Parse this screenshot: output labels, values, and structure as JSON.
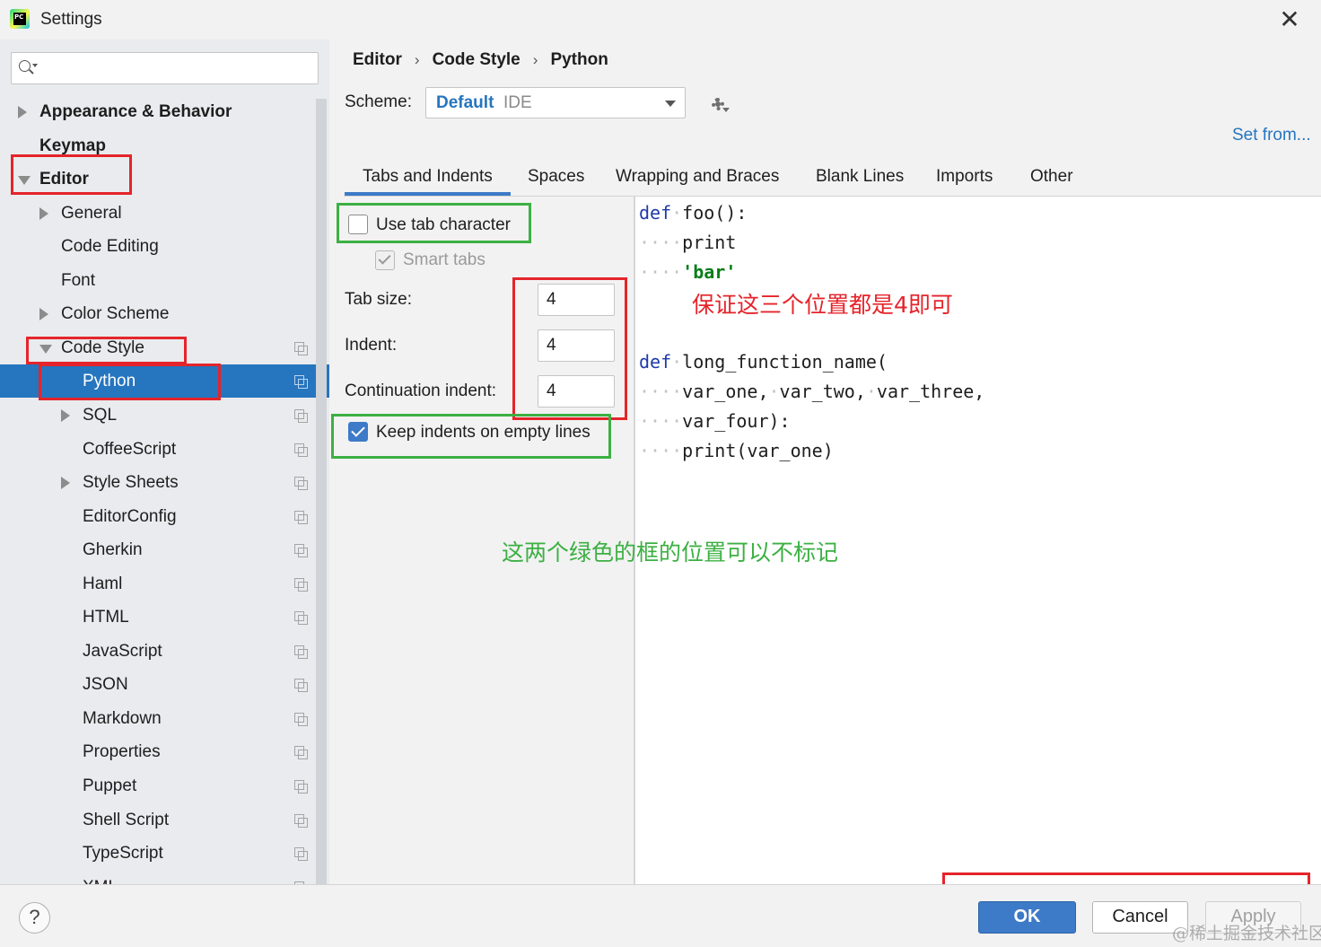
{
  "window": {
    "title": "Settings",
    "close_glyph": "✕",
    "icon": "pycharm-logo",
    "icon_text": "PC"
  },
  "sidebar": {
    "search": {
      "value": "",
      "placeholder": ""
    },
    "items": [
      {
        "label": "Appearance & Behavior",
        "bold": true,
        "arrow": "collapsed",
        "level": 0
      },
      {
        "label": "Keymap",
        "bold": true,
        "arrow": "none",
        "level": 0
      },
      {
        "label": "Editor",
        "bold": true,
        "arrow": "expanded",
        "level": 0
      },
      {
        "label": "General",
        "arrow": "collapsed",
        "level": 1
      },
      {
        "label": "Code Editing",
        "arrow": "none",
        "level": 1
      },
      {
        "label": "Font",
        "arrow": "none",
        "level": 1
      },
      {
        "label": "Color Scheme",
        "arrow": "collapsed",
        "level": 1
      },
      {
        "label": "Code Style",
        "arrow": "expanded",
        "level": 1,
        "copy_icon": true
      },
      {
        "label": "Python",
        "arrow": "none",
        "level": 2,
        "copy_icon": true,
        "selected": true
      },
      {
        "label": "SQL",
        "arrow": "collapsed",
        "level": 2,
        "copy_icon": true
      },
      {
        "label": "CoffeeScript",
        "arrow": "none",
        "level": 2,
        "copy_icon": true
      },
      {
        "label": "Style Sheets",
        "arrow": "collapsed",
        "level": 2,
        "copy_icon": true
      },
      {
        "label": "EditorConfig",
        "arrow": "none",
        "level": 2,
        "copy_icon": true
      },
      {
        "label": "Gherkin",
        "arrow": "none",
        "level": 2,
        "copy_icon": true
      },
      {
        "label": "Haml",
        "arrow": "none",
        "level": 2,
        "copy_icon": true
      },
      {
        "label": "HTML",
        "arrow": "none",
        "level": 2,
        "copy_icon": true
      },
      {
        "label": "JavaScript",
        "arrow": "none",
        "level": 2,
        "copy_icon": true
      },
      {
        "label": "JSON",
        "arrow": "none",
        "level": 2,
        "copy_icon": true
      },
      {
        "label": "Markdown",
        "arrow": "none",
        "level": 2,
        "copy_icon": true
      },
      {
        "label": "Properties",
        "arrow": "none",
        "level": 2,
        "copy_icon": true
      },
      {
        "label": "Puppet",
        "arrow": "none",
        "level": 2,
        "copy_icon": true
      },
      {
        "label": "Shell Script",
        "arrow": "none",
        "level": 2,
        "copy_icon": true
      },
      {
        "label": "TypeScript",
        "arrow": "none",
        "level": 2,
        "copy_icon": true
      },
      {
        "label": "XML",
        "arrow": "none",
        "level": 2,
        "copy_icon": true
      }
    ]
  },
  "breadcrumb": {
    "items": [
      "Editor",
      "Code Style",
      "Python"
    ],
    "separator": "›"
  },
  "scheme": {
    "label": "Scheme:",
    "name": "Default",
    "type": "IDE"
  },
  "set_from": "Set from...",
  "tabs": [
    "Tabs and Indents",
    "Spaces",
    "Wrapping and Braces",
    "Blank Lines",
    "Imports",
    "Other"
  ],
  "active_tab": "Tabs and Indents",
  "options": {
    "use_tab_character": {
      "label": "Use tab character",
      "checked": false
    },
    "smart_tabs": {
      "label": "Smart tabs",
      "checked": true,
      "disabled": true
    },
    "tab_size": {
      "label": "Tab size:",
      "value": "4"
    },
    "indent": {
      "label": "Indent:",
      "value": "4"
    },
    "continuation_indent": {
      "label": "Continuation indent:",
      "value": "4"
    },
    "keep_indents": {
      "label": "Keep indents on empty lines",
      "checked": true
    }
  },
  "code_preview": [
    [
      {
        "t": "def",
        "c": "kw"
      },
      {
        "t": "·",
        "c": "ws"
      },
      {
        "t": "foo():",
        "c": ""
      }
    ],
    [
      {
        "t": "····",
        "c": "ws"
      },
      {
        "t": "print",
        "c": ""
      }
    ],
    [
      {
        "t": "····",
        "c": "ws"
      },
      {
        "t": "'bar'",
        "c": "str"
      }
    ],
    [],
    [],
    [
      {
        "t": "def",
        "c": "kw"
      },
      {
        "t": "·",
        "c": "ws"
      },
      {
        "t": "long_function_name(",
        "c": ""
      }
    ],
    [
      {
        "t": "····",
        "c": "ws"
      },
      {
        "t": "var_one,",
        "c": ""
      },
      {
        "t": "·",
        "c": "ws"
      },
      {
        "t": "var_two,",
        "c": ""
      },
      {
        "t": "·",
        "c": "ws"
      },
      {
        "t": "var_three,",
        "c": ""
      }
    ],
    [
      {
        "t": "····",
        "c": "ws"
      },
      {
        "t": "var_four):",
        "c": ""
      }
    ],
    [
      {
        "t": "····",
        "c": "ws"
      },
      {
        "t": "print(var_one)",
        "c": ""
      }
    ]
  ],
  "annotations": {
    "red_note": "保证这三个位置都是4即可",
    "green_note": "这两个绿色的框的位置可以不标记",
    "red_color": "#e5242b",
    "green_color": "#3cb043"
  },
  "footer": {
    "help": "?",
    "ok": "OK",
    "cancel": "Cancel",
    "apply": "Apply",
    "watermark": "@稀土掘金技术社区"
  },
  "colors": {
    "accent": "#2675bf",
    "button_primary": "#3d7ac7",
    "keyword": "#1f3aa8",
    "string": "#067d17"
  }
}
